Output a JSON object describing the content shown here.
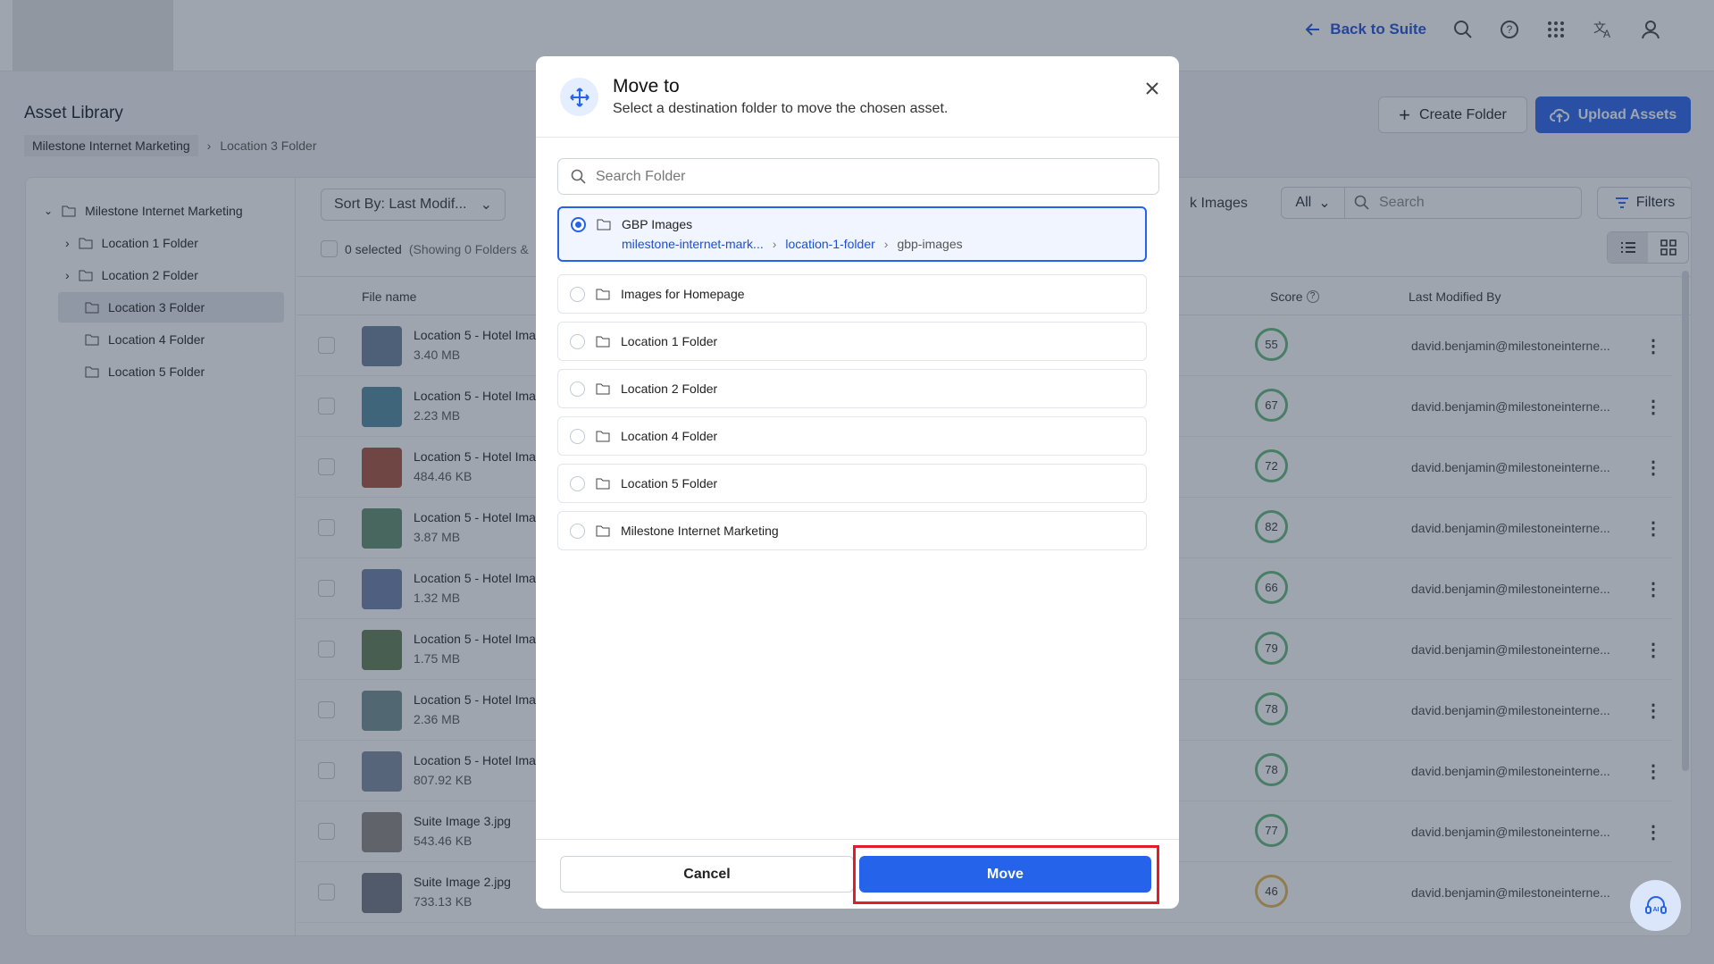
{
  "header": {
    "back_label": "Back to Suite",
    "icons": [
      "search-icon",
      "help-icon",
      "apps-grid-icon",
      "translate-icon",
      "user-icon"
    ]
  },
  "page": {
    "title": "Asset Library",
    "breadcrumb": [
      "Milestone Internet Marketing",
      "Location 3 Folder"
    ],
    "create_folder_label": "Create Folder",
    "upload_assets_label": "Upload Assets"
  },
  "tree": {
    "root": "Milestone Internet Marketing",
    "items": [
      {
        "label": "Location 1 Folder",
        "expandable": true
      },
      {
        "label": "Location 2 Folder",
        "expandable": true
      },
      {
        "label": "Location 3 Folder",
        "expandable": false,
        "selected": true
      },
      {
        "label": "Location 4 Folder",
        "expandable": false
      },
      {
        "label": "Location 5 Folder",
        "expandable": false
      }
    ]
  },
  "toolbar": {
    "sort_label": "Sort By: Last Modif...",
    "selected_count": "0 selected",
    "showing_text": "(Showing 0 Folders &",
    "filter_fragment": "k Images",
    "filter_select": "All",
    "search_placeholder": "Search",
    "filters_label": "Filters"
  },
  "table": {
    "columns": {
      "file_name": "File name",
      "score": "Score",
      "last_modified_by": "Last Modified By"
    },
    "rows": [
      {
        "name": "Location 5 - Hotel Ima",
        "size": "3.40 MB",
        "score": "55",
        "by": "david.benjamin@milestoneinterne..."
      },
      {
        "name": "Location 5 - Hotel Ima",
        "size": "2.23 MB",
        "score": "67",
        "by": "david.benjamin@milestoneinterne..."
      },
      {
        "name": "Location 5 - Hotel Ima",
        "size": "484.46 KB",
        "score": "72",
        "by": "david.benjamin@milestoneinterne..."
      },
      {
        "name": "Location 5 - Hotel Ima",
        "size": "3.87 MB",
        "score": "82",
        "by": "david.benjamin@milestoneinterne..."
      },
      {
        "name": "Location 5 - Hotel Ima",
        "size": "1.32 MB",
        "score": "66",
        "by": "david.benjamin@milestoneinterne..."
      },
      {
        "name": "Location 5 - Hotel Ima",
        "size": "1.75 MB",
        "score": "79",
        "by": "david.benjamin@milestoneinterne..."
      },
      {
        "name": "Location 5 - Hotel Ima",
        "size": "2.36 MB",
        "score": "78",
        "by": "david.benjamin@milestoneinterne..."
      },
      {
        "name": "Location 5 - Hotel Ima",
        "size": "807.92 KB",
        "score": "78",
        "by": "david.benjamin@milestoneinterne..."
      },
      {
        "name": "Suite Image 3.jpg",
        "size": "543.46 KB",
        "score": "77",
        "by": "david.benjamin@milestoneinterne..."
      },
      {
        "name": "Suite Image 2.jpg",
        "size": "733.13 KB",
        "score": "46",
        "by": "david.benjamin@milestoneinterne..."
      }
    ]
  },
  "modal": {
    "title": "Move to",
    "subtitle": "Select a destination folder to move the chosen asset.",
    "search_placeholder": "Search Folder",
    "options": [
      {
        "label": "GBP Images",
        "selected": true,
        "path": [
          "milestone-internet-mark...",
          "location-1-folder",
          "gbp-images"
        ]
      },
      {
        "label": "Images for Homepage"
      },
      {
        "label": "Location 1 Folder"
      },
      {
        "label": "Location 2 Folder"
      },
      {
        "label": "Location 4 Folder"
      },
      {
        "label": "Location 5 Folder"
      },
      {
        "label": "Milestone Internet Marketing"
      }
    ],
    "cancel_label": "Cancel",
    "move_label": "Move"
  },
  "colors": {
    "accent": "#2563eb",
    "highlight": "#e11d2b",
    "score_green": "#5fb878",
    "score_amber": "#e3b64a"
  }
}
